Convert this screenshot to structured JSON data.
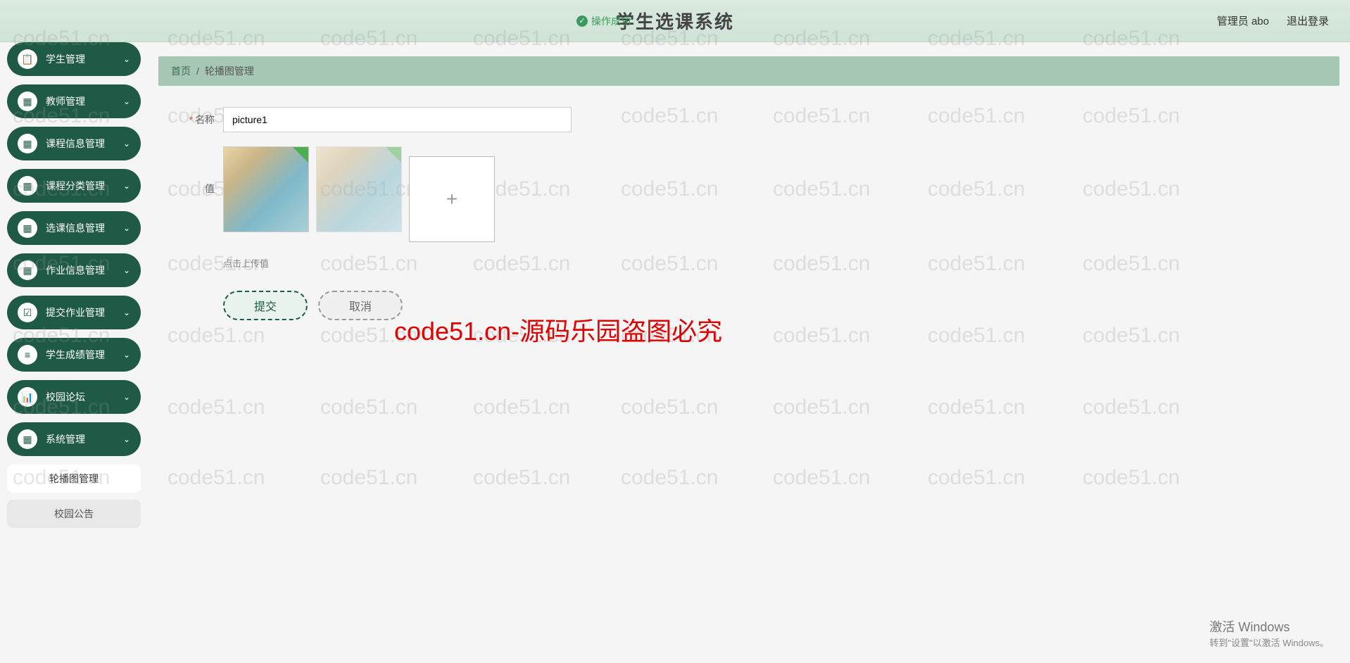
{
  "header": {
    "success_msg": "操作成功",
    "title": "学生选课系统",
    "user_label": "管理员 abo",
    "logout": "退出登录"
  },
  "sidebar": {
    "items": [
      {
        "label": "学生管理",
        "icon": "📋"
      },
      {
        "label": "教师管理",
        "icon": "▦"
      },
      {
        "label": "课程信息管理",
        "icon": "▦"
      },
      {
        "label": "课程分类管理",
        "icon": "▦"
      },
      {
        "label": "选课信息管理",
        "icon": "▦"
      },
      {
        "label": "作业信息管理",
        "icon": "▦"
      },
      {
        "label": "提交作业管理",
        "icon": "☑"
      },
      {
        "label": "学生成绩管理",
        "icon": "≡"
      },
      {
        "label": "校园论坛",
        "icon": "📊"
      },
      {
        "label": "系统管理",
        "icon": "▦"
      }
    ],
    "submenu": [
      {
        "label": "轮播图管理",
        "active": true
      },
      {
        "label": "校园公告",
        "active": false
      }
    ]
  },
  "breadcrumb": {
    "home": "首页",
    "current": "轮播图管理"
  },
  "form": {
    "name_label": "名称",
    "name_value": "picture1",
    "value_label": "值",
    "upload_hint": "点击上传值",
    "submit": "提交",
    "cancel": "取消"
  },
  "watermark": {
    "text": "code51.cn",
    "red_text": "code51.cn-源码乐园盗图必究"
  },
  "windows": {
    "line1": "激活 Windows",
    "line2": "转到\"设置\"以激活 Windows。"
  }
}
